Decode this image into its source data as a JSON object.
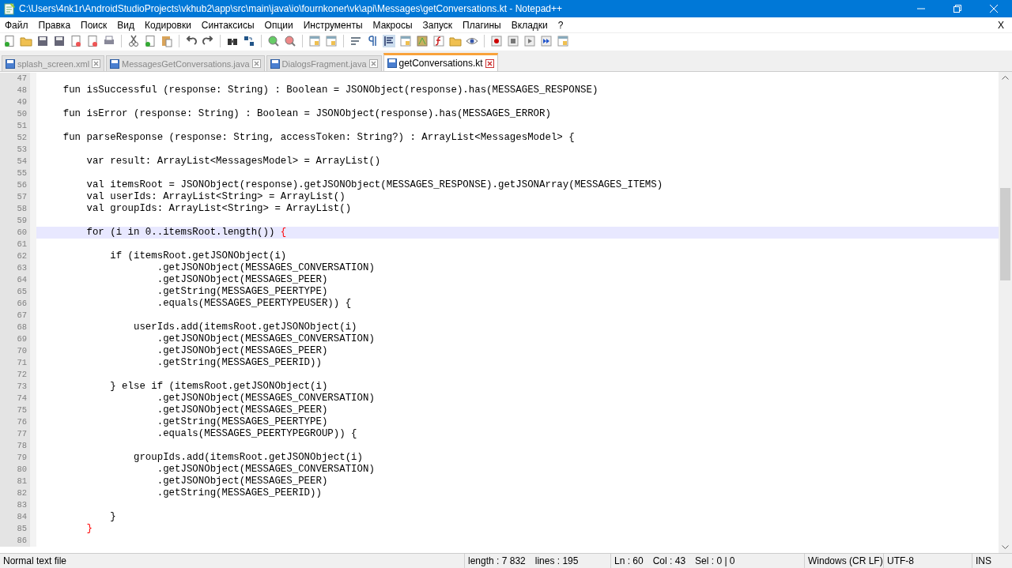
{
  "window": {
    "title": "C:\\Users\\4nk1r\\AndroidStudioProjects\\vkhub2\\app\\src\\main\\java\\io\\fournkoner\\vk\\api\\Messages\\getConversations.kt - Notepad++"
  },
  "menu": {
    "items": [
      "Файл",
      "Правка",
      "Поиск",
      "Вид",
      "Кодировки",
      "Синтаксисы",
      "Опции",
      "Инструменты",
      "Макросы",
      "Запуск",
      "Плагины",
      "Вкладки",
      "?"
    ],
    "close_label": "X"
  },
  "tabs": [
    {
      "label": "splash_screen.xml",
      "selected": false
    },
    {
      "label": "MessagesGetConversations.java",
      "selected": false
    },
    {
      "label": "DialogsFragment.java",
      "selected": false
    },
    {
      "label": "getConversations.kt",
      "selected": true
    }
  ],
  "lines": [
    {
      "number": "47"
    },
    {
      "number": "48",
      "text": "    fun isSuccessful (response: String) : Boolean = JSONObject(response).has(MESSAGES_RESPONSE)"
    },
    {
      "number": "49"
    },
    {
      "number": "50",
      "text": "    fun isError (response: String) : Boolean = JSONObject(response).has(MESSAGES_ERROR)"
    },
    {
      "number": "51"
    },
    {
      "number": "52",
      "text": "    fun parseResponse (response: String, accessToken: String?) : ArrayList<MessagesModel> {"
    },
    {
      "number": "53"
    },
    {
      "number": "54",
      "text": "        var result: ArrayList<MessagesModel> = ArrayList()"
    },
    {
      "number": "55"
    },
    {
      "number": "56",
      "text": "        val itemsRoot = JSONObject(response).getJSONObject(MESSAGES_RESPONSE).getJSONArray(MESSAGES_ITEMS)"
    },
    {
      "number": "57",
      "text": "        val userIds: ArrayList<String> = ArrayList()"
    },
    {
      "number": "58",
      "text": "        val groupIds: ArrayList<String> = ArrayList()"
    },
    {
      "number": "59"
    },
    {
      "number": "60",
      "text": "        for (i in 0..itemsRoot.length()) {",
      "current": true,
      "brace_match": true
    },
    {
      "number": "61"
    },
    {
      "number": "62",
      "text": "            if (itemsRoot.getJSONObject(i)"
    },
    {
      "number": "63",
      "text": "                    .getJSONObject(MESSAGES_CONVERSATION)"
    },
    {
      "number": "64",
      "text": "                    .getJSONObject(MESSAGES_PEER)"
    },
    {
      "number": "65",
      "text": "                    .getString(MESSAGES_PEERTYPE)"
    },
    {
      "number": "66",
      "text": "                    .equals(MESSAGES_PEERTYPEUSER)) {"
    },
    {
      "number": "67"
    },
    {
      "number": "68",
      "text": "                userIds.add(itemsRoot.getJSONObject(i)"
    },
    {
      "number": "69",
      "text": "                    .getJSONObject(MESSAGES_CONVERSATION)"
    },
    {
      "number": "70",
      "text": "                    .getJSONObject(MESSAGES_PEER)"
    },
    {
      "number": "71",
      "text": "                    .getString(MESSAGES_PEERID))"
    },
    {
      "number": "72"
    },
    {
      "number": "73",
      "text": "            } else if (itemsRoot.getJSONObject(i)"
    },
    {
      "number": "74",
      "text": "                    .getJSONObject(MESSAGES_CONVERSATION)"
    },
    {
      "number": "75",
      "text": "                    .getJSONObject(MESSAGES_PEER)"
    },
    {
      "number": "76",
      "text": "                    .getString(MESSAGES_PEERTYPE)"
    },
    {
      "number": "77",
      "text": "                    .equals(MESSAGES_PEERTYPEGROUP)) {"
    },
    {
      "number": "78"
    },
    {
      "number": "79",
      "text": "                groupIds.add(itemsRoot.getJSONObject(i)"
    },
    {
      "number": "80",
      "text": "                    .getJSONObject(MESSAGES_CONVERSATION)"
    },
    {
      "number": "81",
      "text": "                    .getJSONObject(MESSAGES_PEER)"
    },
    {
      "number": "82",
      "text": "                    .getString(MESSAGES_PEERID))"
    },
    {
      "number": "83"
    },
    {
      "number": "84",
      "text": "            }"
    },
    {
      "number": "85",
      "text": "        }",
      "brace_match": true
    },
    {
      "number": "86"
    }
  ],
  "status_bar": {
    "file_type": "Normal text file",
    "length": "length : 7 832",
    "lines": "lines : 195",
    "line": "Ln : 60",
    "column": "Col : 43",
    "selection": "Sel : 0 | 0",
    "eol": "Windows (CR LF)",
    "encoding": "UTF-8",
    "mode": "INS"
  }
}
